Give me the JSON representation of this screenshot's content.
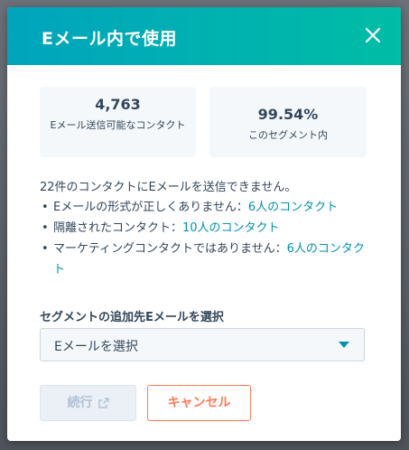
{
  "header": {
    "title": "Eメール内で使用"
  },
  "stats": [
    {
      "value": "4,763",
      "label": "Eメール送信可能なコンタクト"
    },
    {
      "value": "99.54%",
      "label": "このセグメント内"
    }
  ],
  "warning": {
    "intro": "22件のコンタクトにEメールを送信できません。",
    "items": [
      {
        "text": "Eメールの形式が正しくありません：",
        "link": "6人のコンタクト"
      },
      {
        "text": "隔離されたコンタクト：",
        "link": "10人のコンタクト"
      },
      {
        "text": "マーケティングコンタクトではありません：",
        "link": "6人のコンタクト"
      }
    ],
    "bullet": "•"
  },
  "select": {
    "label": "セグメントの追加先Eメールを選択",
    "value": "Eメールを選択"
  },
  "footer": {
    "continue_label": "続行",
    "cancel_label": "キャンセル"
  },
  "icons": {
    "close": "close-icon",
    "caret": "caret-down-icon",
    "external": "external-link-icon"
  },
  "colors": {
    "header_start": "#00a4bd",
    "header_end": "#00bda5",
    "link": "#0091ae",
    "cancel": "#ff7a59"
  }
}
